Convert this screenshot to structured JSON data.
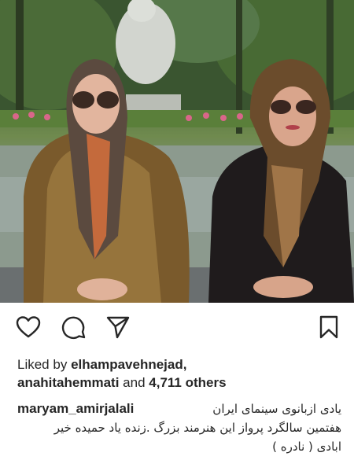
{
  "post": {
    "photo_alt": "",
    "liked_by_prefix": "Liked by",
    "liked_by_user": "elhampavehnejad,",
    "second_user": "anahitahemmati",
    "and_word": "and",
    "others_count": "4,711 others",
    "caption_user": "maryam_amirjalali",
    "caption_line1": "یادی ازبانوی سینمای ایران",
    "caption_line2": "هفتمین سالگرد پرواز این هنرمند بزرگ .زنده یاد حمیده خیر",
    "caption_line3": "ابادی ( نادره )"
  },
  "icons": {
    "like": "heart-icon",
    "comment": "comment-icon",
    "share": "send-icon",
    "save": "bookmark-icon"
  },
  "colors": {
    "text": "#262626",
    "background": "#ffffff"
  }
}
